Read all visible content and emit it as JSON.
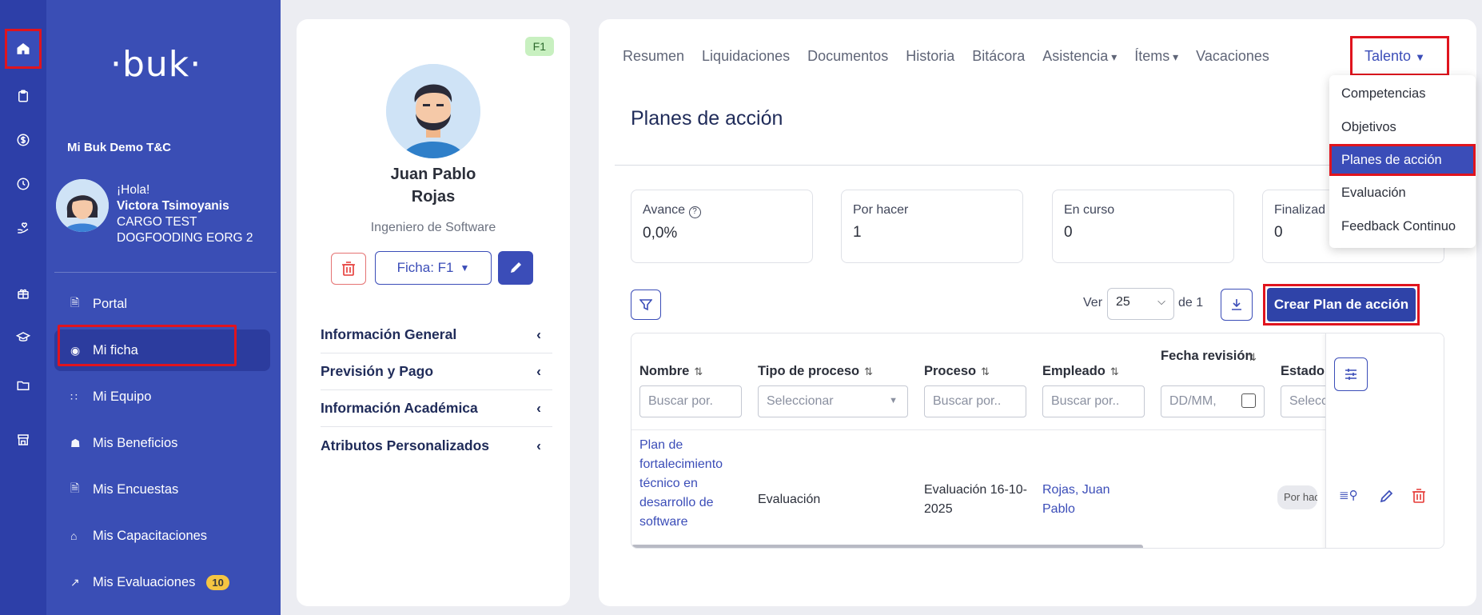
{
  "rail": {
    "icons": [
      "home-icon",
      "clipboard-icon",
      "dollar-icon",
      "clock-icon",
      "hand-heart-icon",
      "gift-icon",
      "graduation-icon",
      "folder-icon",
      "store-icon"
    ]
  },
  "sidebar": {
    "logo": "·buk·",
    "company": "Mi Buk Demo T&C",
    "greeting": "¡Hola!",
    "user_name": "Victora Tsimoyanis",
    "user_role_1": "CARGO TEST",
    "user_role_2": "DOGFOODING EORG 2",
    "items": [
      {
        "label": "Portal",
        "icon": "document-icon"
      },
      {
        "label": "Mi ficha",
        "icon": "user-circle-icon"
      },
      {
        "label": "Mi Equipo",
        "icon": "team-icon"
      },
      {
        "label": "Mis Beneficios",
        "icon": "gift-icon"
      },
      {
        "label": "Mis Encuestas",
        "icon": "survey-icon"
      },
      {
        "label": "Mis Capacitaciones",
        "icon": "graduation-icon"
      },
      {
        "label": "Mis Evaluaciones",
        "icon": "trend-icon",
        "badge": "10"
      }
    ]
  },
  "profile": {
    "tag": "F1",
    "name_line1": "Juan Pablo",
    "name_line2": "Rojas",
    "role": "Ingeniero de Software",
    "ficha_label": "Ficha: F1",
    "sections": [
      "Información General",
      "Previsión y Pago",
      "Información Académica",
      "Atributos Personalizados"
    ]
  },
  "tabs": [
    "Resumen",
    "Liquidaciones",
    "Documentos",
    "Historia",
    "Bitácora",
    "Asistencia",
    "Ítems",
    "Vacaciones"
  ],
  "active_tab": "Talento",
  "page_title": "Planes de acción",
  "stats": [
    {
      "label": "Avance",
      "value": "0,0%"
    },
    {
      "label": "Por hacer",
      "value": "1"
    },
    {
      "label": "En curso",
      "value": "0"
    },
    {
      "label": "Finalizad",
      "value": "0"
    }
  ],
  "toolbar": {
    "ver_label": "Ver",
    "page_size": "25",
    "de_label": "de 1",
    "create_label": "Crear Plan de acción"
  },
  "table": {
    "headers": [
      "Nombre",
      "Tipo de proceso",
      "Proceso",
      "Empleado",
      "Fecha revisión",
      "Estado"
    ],
    "filters": [
      "Buscar por.",
      "Seleccionar",
      "Buscar por..",
      "Buscar por..",
      "DD/MM,",
      "Selecc"
    ],
    "row": {
      "nombre": "Plan de fortalecimiento técnico en desarrollo de software",
      "tipo": "Evaluación",
      "proceso": "Evaluación 16-10-2025",
      "empleado": "Rojas, Juan Pablo",
      "estado": "Por hacer"
    }
  },
  "dropdown": [
    "Competencias",
    "Objetivos",
    "Planes de acción",
    "Evaluación",
    "Feedback Continuo"
  ],
  "colors": {
    "primary": "#2f43a8",
    "sidebar": "#3a4eb5",
    "highlight": "#e0141e"
  }
}
